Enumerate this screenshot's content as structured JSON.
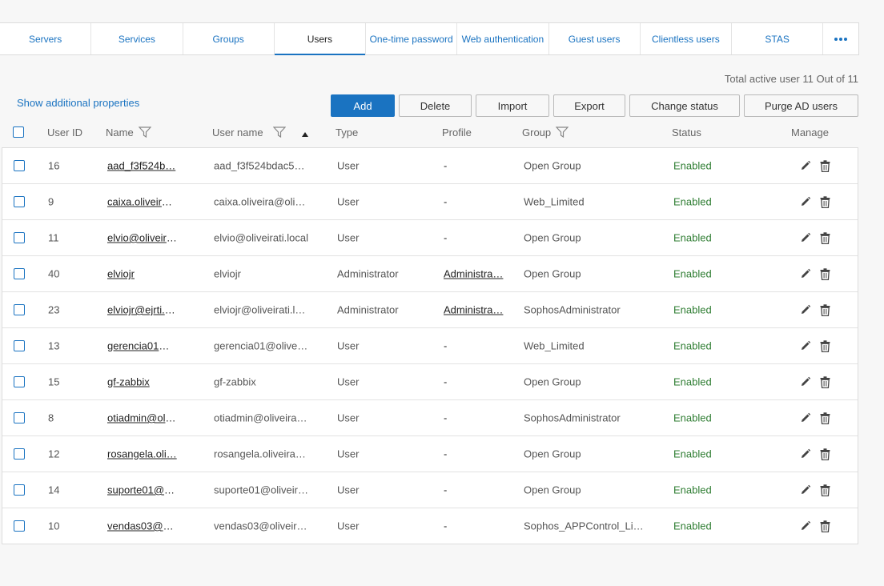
{
  "tabs": [
    {
      "label": "Servers"
    },
    {
      "label": "Services"
    },
    {
      "label": "Groups"
    },
    {
      "label": "Users"
    },
    {
      "label": "One-time password"
    },
    {
      "label": "Web authentication"
    },
    {
      "label": "Guest users"
    },
    {
      "label": "Clientless users"
    },
    {
      "label": "STAS"
    }
  ],
  "active_tab": "Users",
  "summary": {
    "total_text": "Total active user 11 Out of 11"
  },
  "show_additional": "Show additional properties",
  "toolbar": {
    "add": "Add",
    "delete": "Delete",
    "import": "Import",
    "export": "Export",
    "change_status": "Change status",
    "purge": "Purge AD users"
  },
  "columns": {
    "user_id": "User ID",
    "name": "Name",
    "user_name": "User name",
    "type": "Type",
    "profile": "Profile",
    "group": "Group",
    "status": "Status",
    "manage": "Manage"
  },
  "rows": [
    {
      "id": "16",
      "name": "aad_f3f524b…",
      "user": "aad_f3f524bdac5…",
      "type": "User",
      "profile": "-",
      "group": "Open Group",
      "status": "Enabled"
    },
    {
      "id": "9",
      "name": "caixa.oliveira…",
      "user": "caixa.oliveira@oliv…",
      "type": "User",
      "profile": "-",
      "group": "Web_Limited",
      "status": "Enabled"
    },
    {
      "id": "11",
      "name": "elvio@oliveira…",
      "user": "elvio@oliveirati.local",
      "type": "User",
      "profile": "-",
      "group": "Open Group",
      "status": "Enabled"
    },
    {
      "id": "40",
      "name": "elviojr",
      "user": "elviojr",
      "type": "Administrator",
      "profile": "Administra…",
      "group": "Open Group",
      "status": "Enabled"
    },
    {
      "id": "23",
      "name": "elviojr@ejrti.c…",
      "user": "elviojr@oliveirati.lo…",
      "type": "Administrator",
      "profile": "Administra…",
      "group": "SophosAdministrator",
      "status": "Enabled"
    },
    {
      "id": "13",
      "name": "gerencia01@…",
      "user": "gerencia01@olivei…",
      "type": "User",
      "profile": "-",
      "group": "Web_Limited",
      "status": "Enabled"
    },
    {
      "id": "15",
      "name": "gf-zabbix",
      "user": "gf-zabbix",
      "type": "User",
      "profile": "-",
      "group": "Open Group",
      "status": "Enabled"
    },
    {
      "id": "8",
      "name": "otiadmin@oli…",
      "user": "otiadmin@oliveirat…",
      "type": "User",
      "profile": "-",
      "group": "SophosAdministrator",
      "status": "Enabled"
    },
    {
      "id": "12",
      "name": "rosangela.oli…",
      "user": "rosangela.oliveira…",
      "type": "User",
      "profile": "-",
      "group": "Open Group",
      "status": "Enabled"
    },
    {
      "id": "14",
      "name": "suporte01@o…",
      "user": "suporte01@oliveir…",
      "type": "User",
      "profile": "-",
      "group": "Open Group",
      "status": "Enabled"
    },
    {
      "id": "10",
      "name": "vendas03@ol…",
      "user": "vendas03@oliveir…",
      "type": "User",
      "profile": "-",
      "group": "Sophos_APPControl_Li…",
      "status": "Enabled"
    }
  ],
  "colors": {
    "accent": "#1a73c1",
    "enabled": "#2e7d32"
  }
}
